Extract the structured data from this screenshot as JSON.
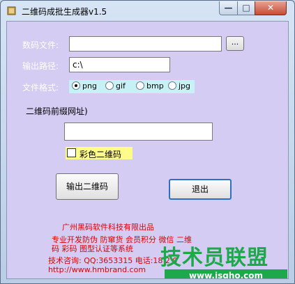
{
  "window": {
    "title": "二维码成批生成器v1.5"
  },
  "titlebar": {
    "minimize": "—",
    "maximize": "□",
    "close": "✕"
  },
  "form": {
    "data_file_label": "数码文件:",
    "data_file_value": "",
    "browse_label": "...",
    "output_path_label": "输出路径:",
    "output_path_value": "c:\\",
    "format_label": "文件格式:",
    "formats": [
      "png",
      "gif",
      "bmp",
      "jpg"
    ],
    "selected_format": "png",
    "prefix_label": "二维码前缀网址)",
    "prefix_value": "",
    "color_qr_label": "彩色二维码",
    "color_qr_checked": false
  },
  "buttons": {
    "output": "输出二维码",
    "exit": "退出"
  },
  "info": {
    "company": "广州黑码软件科技有限出品",
    "line1": "专业开发防伪 防窜货 会员积分 微信 二维",
    "line2": "码 彩码 图型认证等系统",
    "contact": "技术咨询: QQ:3653315 电话:18 2 0",
    "url": "http://www.hmbrand.com"
  },
  "watermark": {
    "text": "技术员联盟",
    "url": "www.jsgho.com"
  },
  "colors": {
    "accent": "#1ea84c",
    "info_text": "#e00000",
    "client_bg": "#d4ccf2"
  }
}
